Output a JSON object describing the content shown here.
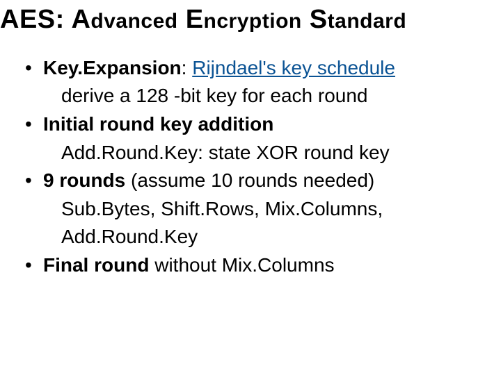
{
  "title": {
    "prefix_big": "AES:",
    "space": " ",
    "w1a": "A",
    "w1b": "dvanced",
    "w2a": "E",
    "w2b": "ncryption",
    "w3a": "S",
    "w3b": "tandard"
  },
  "bullets": [
    {
      "bold": "Key.Expansion",
      "after_bold": ": ",
      "link": "Rijndael's key schedule",
      "cont": "derive a 128 -bit key for each round"
    },
    {
      "bold": "Initial round key addition",
      "after_bold": "",
      "cont": "Add.Round.Key: state XOR round key"
    },
    {
      "bold": "9 rounds",
      "after_bold": " (assume 10 rounds needed)",
      "cont": "Sub.Bytes, Shift.Rows, Mix.Columns, Add.Round.Key"
    },
    {
      "bold": "Final round",
      "after_bold": " without Mix.Columns"
    }
  ]
}
